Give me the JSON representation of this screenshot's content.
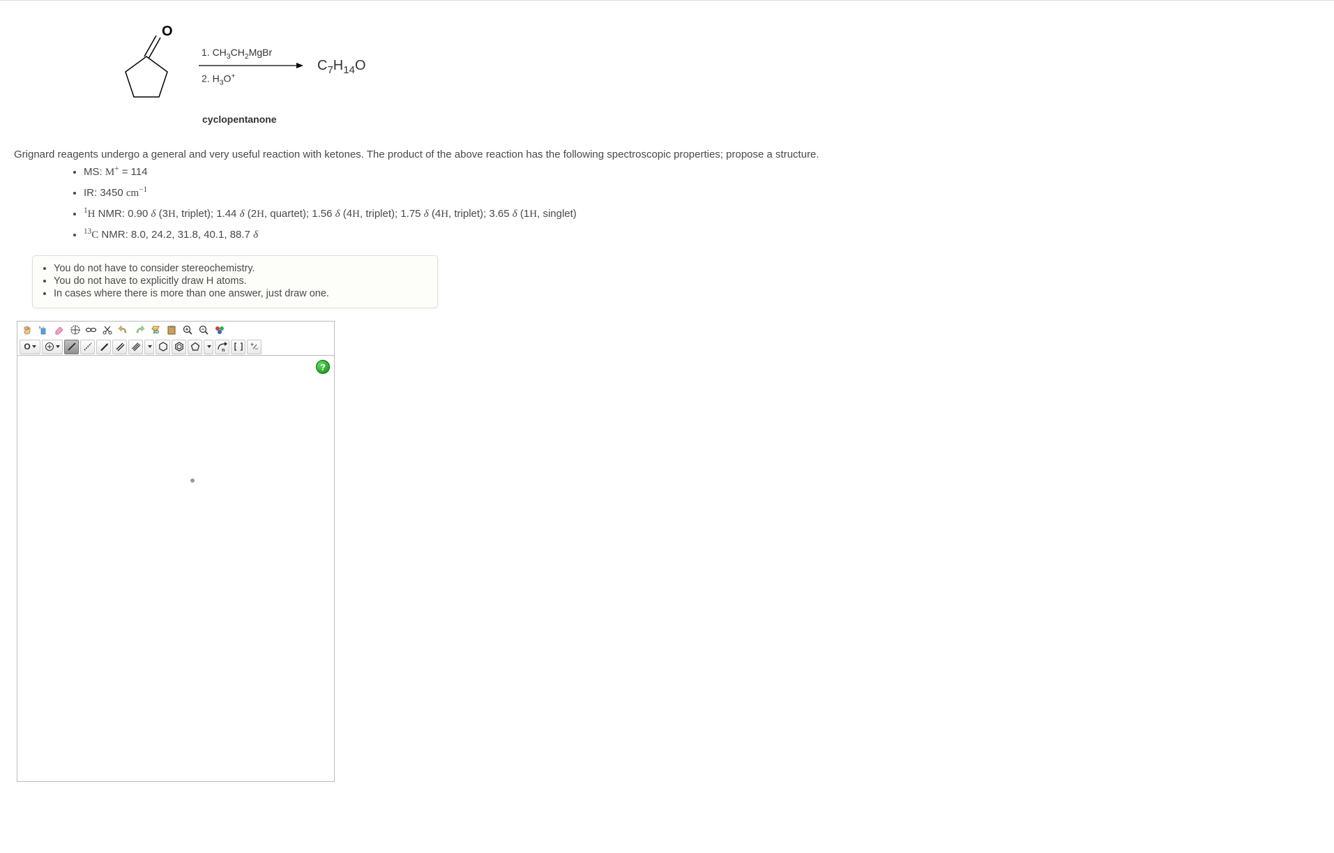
{
  "reaction": {
    "reactant_label": "cyclopentanone",
    "reagent_top": "1. CH₃CH₂MgBr",
    "reagent_bottom": "2. H₃O⁺",
    "product_formula": "C₇H₁₄O"
  },
  "body_text": "Grignard reagents undergo a general and very useful reaction with ketones. The product of the above reaction has the following spectroscopic properties; propose a structure.",
  "spec": {
    "ms": "MS: M⁺ = 114",
    "ir": "IR: 3450 cm⁻¹",
    "hnmr": "¹H NMR: 0.90 𝛿 (3H, triplet); 1.44 𝛿 (2H, quartet); 1.56 𝛿 (4H, triplet); 1.75 𝛿 (4H, triplet); 3.65 𝛿 (1H, singlet)",
    "cnmr": "¹³C NMR: 8.0, 24.2, 31.8, 40.1, 88.7 𝛿"
  },
  "instructions": {
    "i1": "You do not have to consider stereochemistry.",
    "i2": "You do not have to explicitly draw H atoms.",
    "i3": "In cases where there is more than one answer, just draw one."
  },
  "toolbar": {
    "element_sel": "O",
    "help": "?"
  }
}
